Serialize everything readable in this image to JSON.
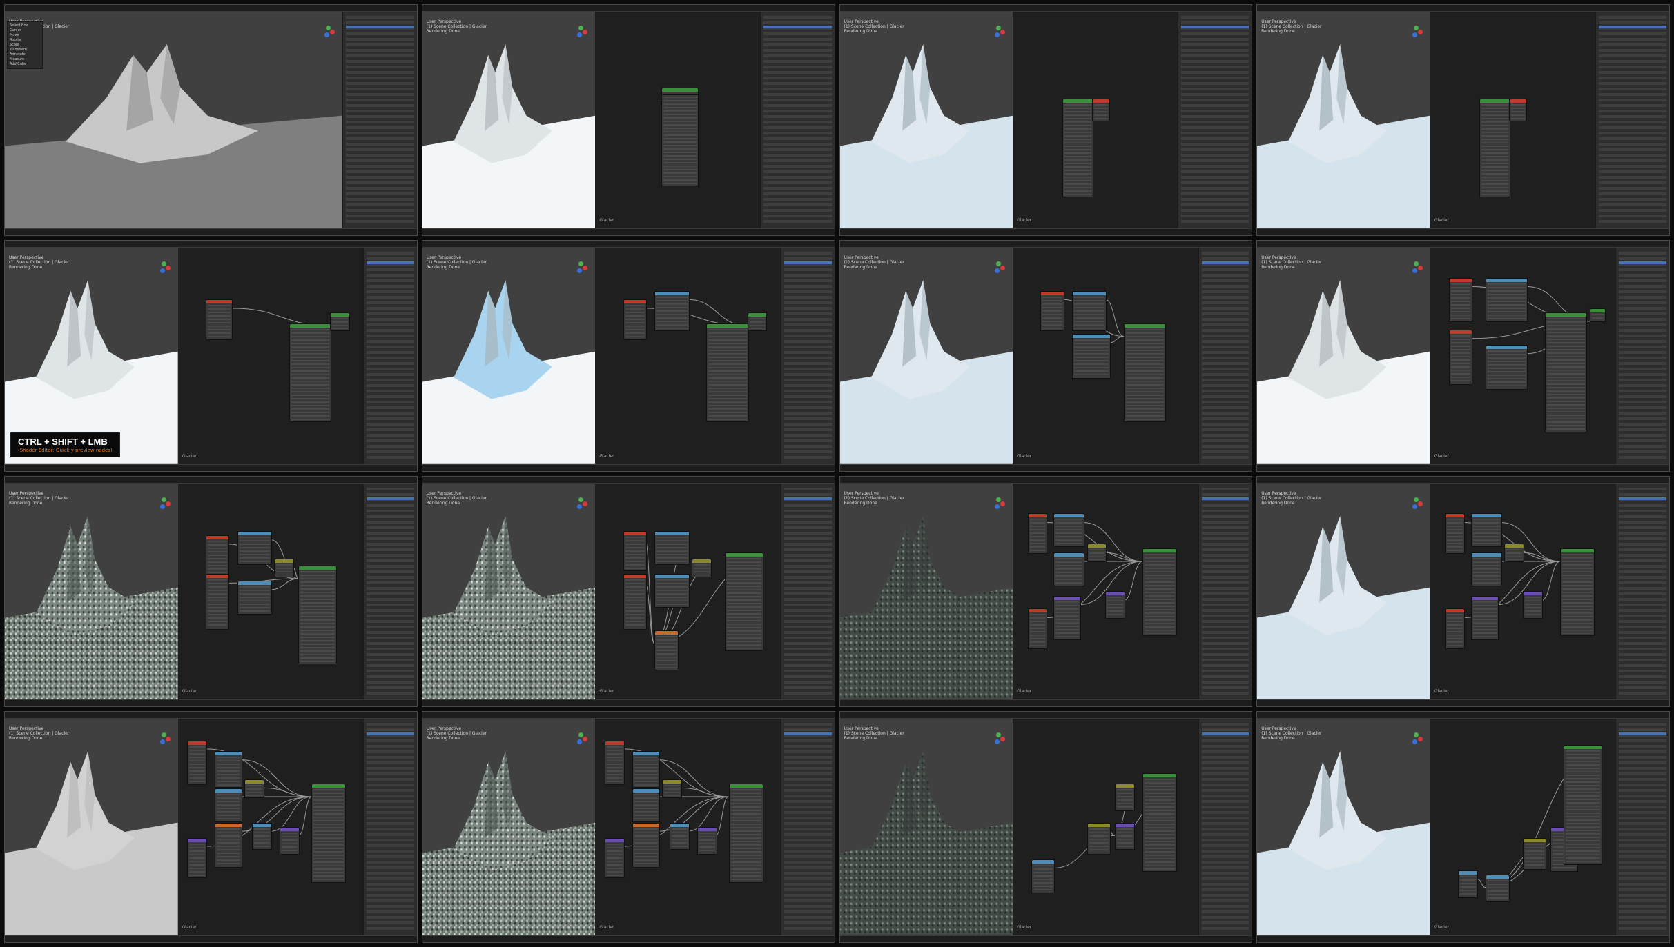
{
  "hud": {
    "line1": "User Perspective",
    "line2": "(1) Scene Collection | Glacier",
    "line3": "Rendering Done"
  },
  "toolbar": {
    "items": [
      "Select Box",
      "Cursor",
      "Move",
      "Rotate",
      "Scale",
      "Transform",
      "Annotate",
      "Measure",
      "Add Cube"
    ]
  },
  "shortcut": {
    "keys": "CTRL + SHIFT + LMB",
    "sub": "(Shader Editor: Quickly preview nodes)"
  },
  "node_editor": {
    "footer": "Glacier"
  },
  "colors": {
    "node_shader": "#3a8f3a",
    "node_texture": "#c0392b",
    "node_input": "#4e8db8",
    "node_converter": "#8a8a2a",
    "node_vector": "#6a4fb0",
    "node_color": "#c46a2a",
    "selection": "#4772b3"
  }
}
